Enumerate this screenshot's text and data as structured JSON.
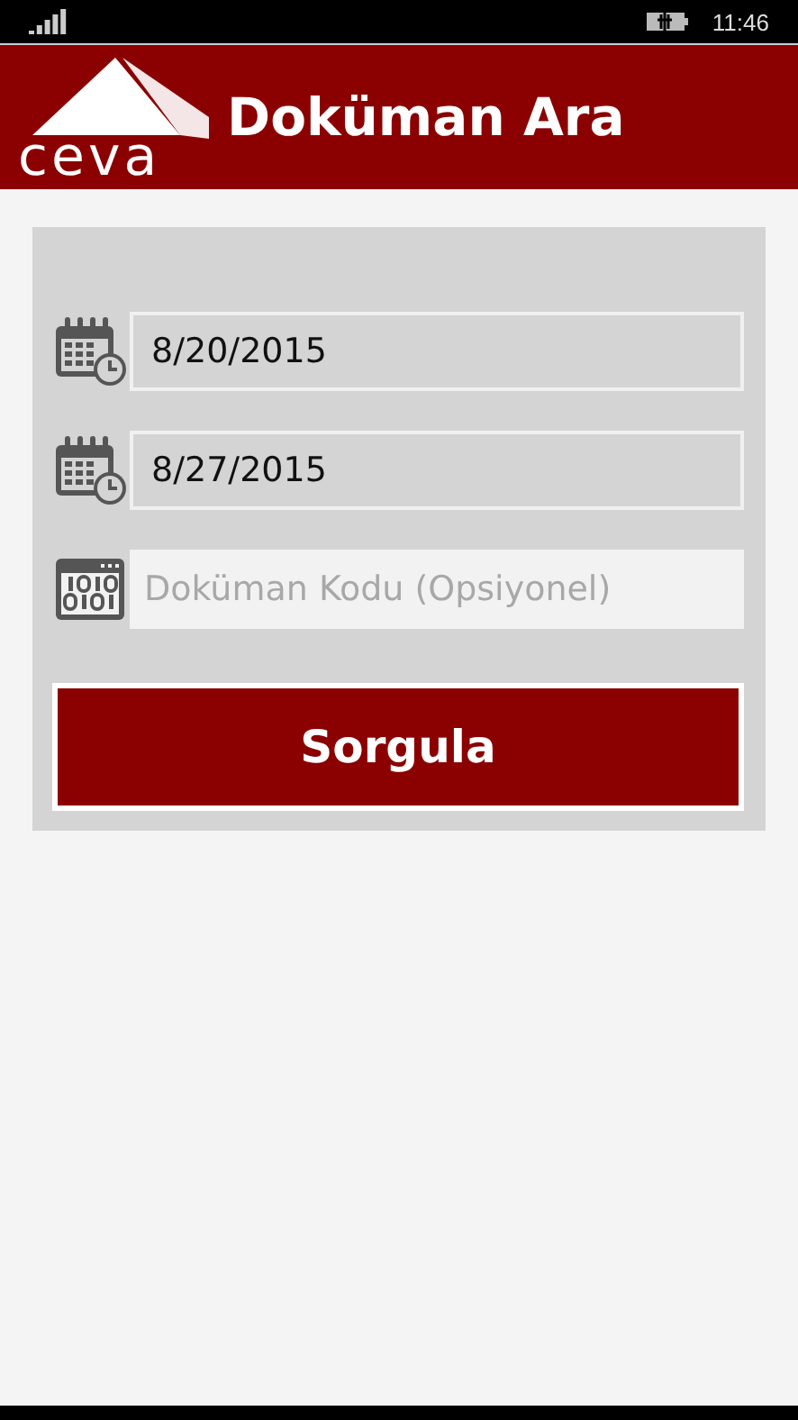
{
  "status_bar": {
    "time": "11:46"
  },
  "header": {
    "logo_text": "ceva",
    "title": "Doküman Ara"
  },
  "fields": [
    {
      "kind": "date",
      "value": "8/20/2015"
    },
    {
      "kind": "date",
      "value": "8/27/2015"
    },
    {
      "kind": "code",
      "placeholder": "Doküman Kodu (Opsiyonel)"
    }
  ],
  "button": {
    "label": "Sorgula"
  }
}
